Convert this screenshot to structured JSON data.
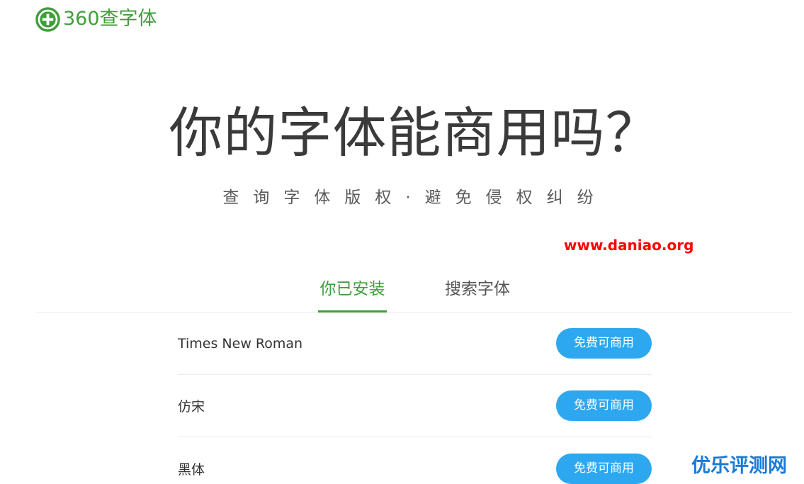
{
  "header": {
    "logo_text": "360查字体",
    "logo_icon": "plus-circle-icon",
    "brand_color": "#3f9e3a"
  },
  "hero": {
    "title": "你的字体能商用吗？",
    "subtitle": "查询字体版权·避免侵权纠纷"
  },
  "watermarks": {
    "top": "www.daniao.org",
    "bottom": "优乐评测网"
  },
  "tabs": [
    {
      "label": "你已安装",
      "active": true
    },
    {
      "label": "搜索字体",
      "active": false
    }
  ],
  "fonts": [
    {
      "name": "Times New Roman",
      "status": "免费可商用"
    },
    {
      "name": "仿宋",
      "status": "免费可商用"
    },
    {
      "name": "黑体",
      "status": "免费可商用"
    }
  ],
  "colors": {
    "active_tab": "#3f9e3a",
    "status_button": "#2da8f0",
    "watermark_top": "#ff0000",
    "watermark_bottom": "#1a7ad6"
  }
}
